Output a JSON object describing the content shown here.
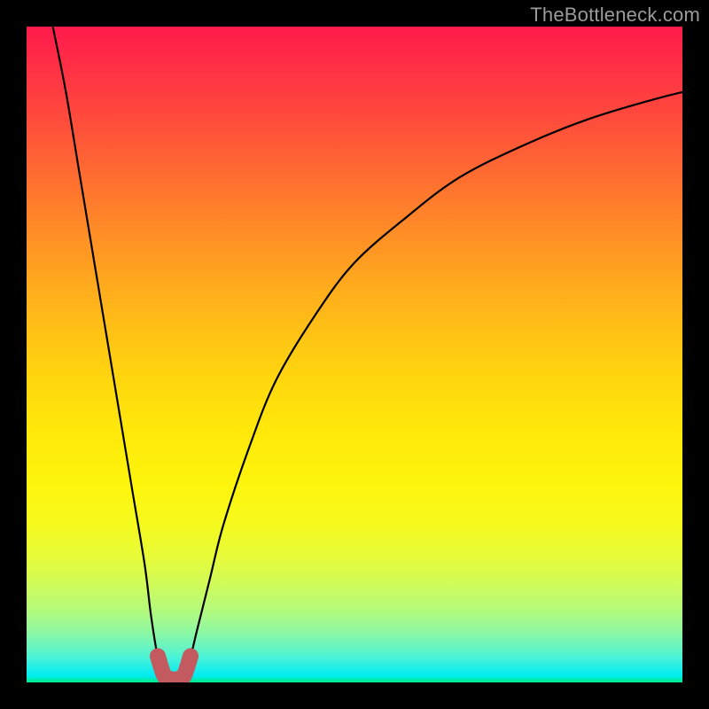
{
  "watermark": "TheBottleneck.com",
  "chart_data": {
    "type": "line",
    "title": "",
    "xlabel": "",
    "ylabel": "",
    "xlim": [
      0,
      100
    ],
    "ylim": [
      0,
      100
    ],
    "grid": false,
    "legend": false,
    "background_gradient": {
      "top_color": "#ff1a4b",
      "mid_color": "#ffe90a",
      "bottom_color": "#00eb85",
      "meaning": "vertical gradient red→yellow→green (high→low bottleneck)"
    },
    "series": [
      {
        "name": "left-branch",
        "x": [
          4,
          6,
          8,
          10,
          12,
          14,
          16,
          18,
          19,
          20,
          21
        ],
        "y": [
          100,
          90,
          78,
          66,
          54,
          42,
          30,
          18,
          10,
          4,
          2
        ]
      },
      {
        "name": "right-branch",
        "x": [
          24,
          25,
          26,
          28,
          30,
          34,
          38,
          44,
          50,
          58,
          66,
          76,
          86,
          96,
          100
        ],
        "y": [
          2,
          4,
          8,
          16,
          24,
          36,
          46,
          56,
          64,
          71,
          77,
          82,
          86,
          89,
          90
        ]
      },
      {
        "name": "bottom-dip-marker",
        "color": "#c35a5f",
        "x": [
          20,
          21,
          22,
          23,
          24,
          25
        ],
        "y": [
          4,
          1,
          0.5,
          0.5,
          1,
          4
        ]
      }
    ],
    "notes": "Values are percentages read against the implicit 0–100 axes of the square plot; no numeric tick labels are rendered in the source image."
  }
}
